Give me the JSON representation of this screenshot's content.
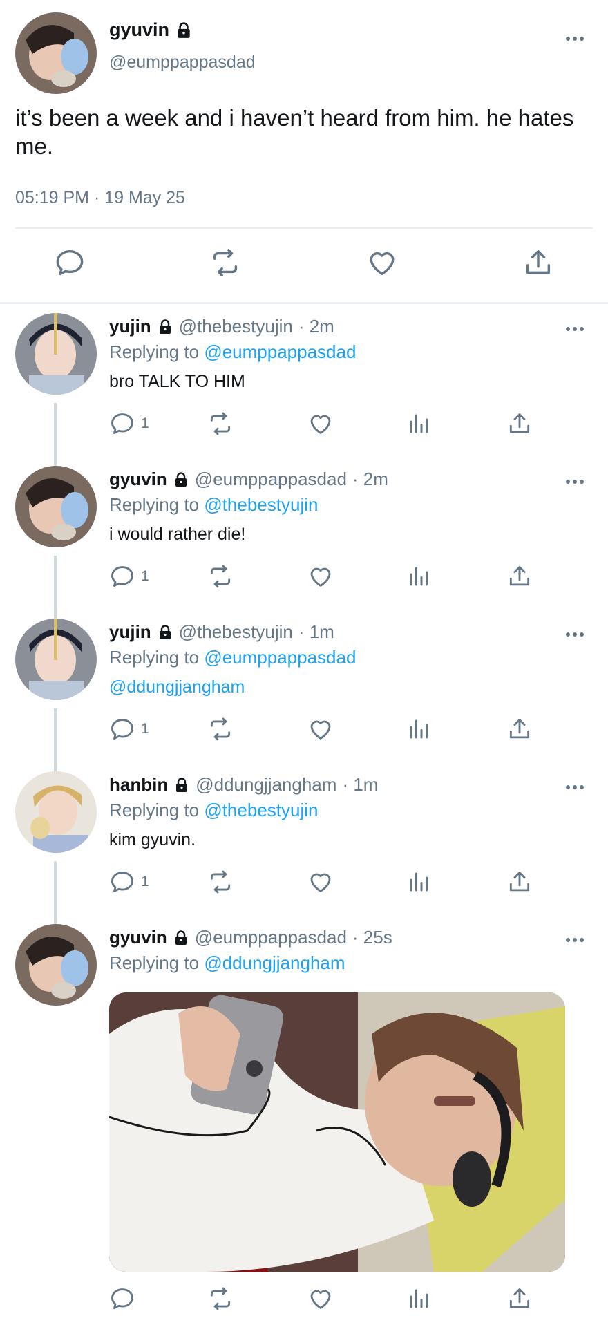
{
  "main_tweet": {
    "name": "gyuvin",
    "handle": "@eumppappasdad",
    "text": "it’s been a week and i haven’t heard from him. he hates me.",
    "timestamp": "05:19 PM · 19 May 25",
    "icons": [
      "reply-icon",
      "retweet-icon",
      "like-icon",
      "share-icon"
    ]
  },
  "replies": [
    {
      "name": "yujin",
      "handle": "@thebestyujin",
      "time": "· 2m",
      "replying_prefix": "Replying to",
      "replying_to": "@eumppappasdad",
      "text": "bro TALK TO HIM",
      "reply_count": "1"
    },
    {
      "name": "gyuvin",
      "handle": "@eumppappasdad",
      "time": "· 2m",
      "replying_prefix": "Replying to",
      "replying_to": "@thebestyujin",
      "text": "i would rather die!",
      "reply_count": "1"
    },
    {
      "name": "yujin",
      "handle": "@thebestyujin",
      "time": "· 1m",
      "replying_prefix": "Replying to",
      "replying_to": "@eumppappasdad",
      "text": "@ddungjjangham",
      "reply_count": "1"
    },
    {
      "name": "hanbin",
      "handle": "@ddungjjangham",
      "time": "· 1m",
      "replying_prefix": "Replying to",
      "replying_to": "@thebestyujin",
      "text": "kim gyuvin.",
      "reply_count": "1"
    },
    {
      "name": "gyuvin",
      "handle": "@eumppappasdad",
      "time": "· 25s",
      "replying_prefix": "Replying to",
      "replying_to": "@ddungjjangham",
      "text": "",
      "reply_count": ""
    }
  ],
  "colors": {
    "accent": "#1da1f2",
    "muted": "#657786",
    "text": "#14171a",
    "divider": "#e6ecf0"
  }
}
